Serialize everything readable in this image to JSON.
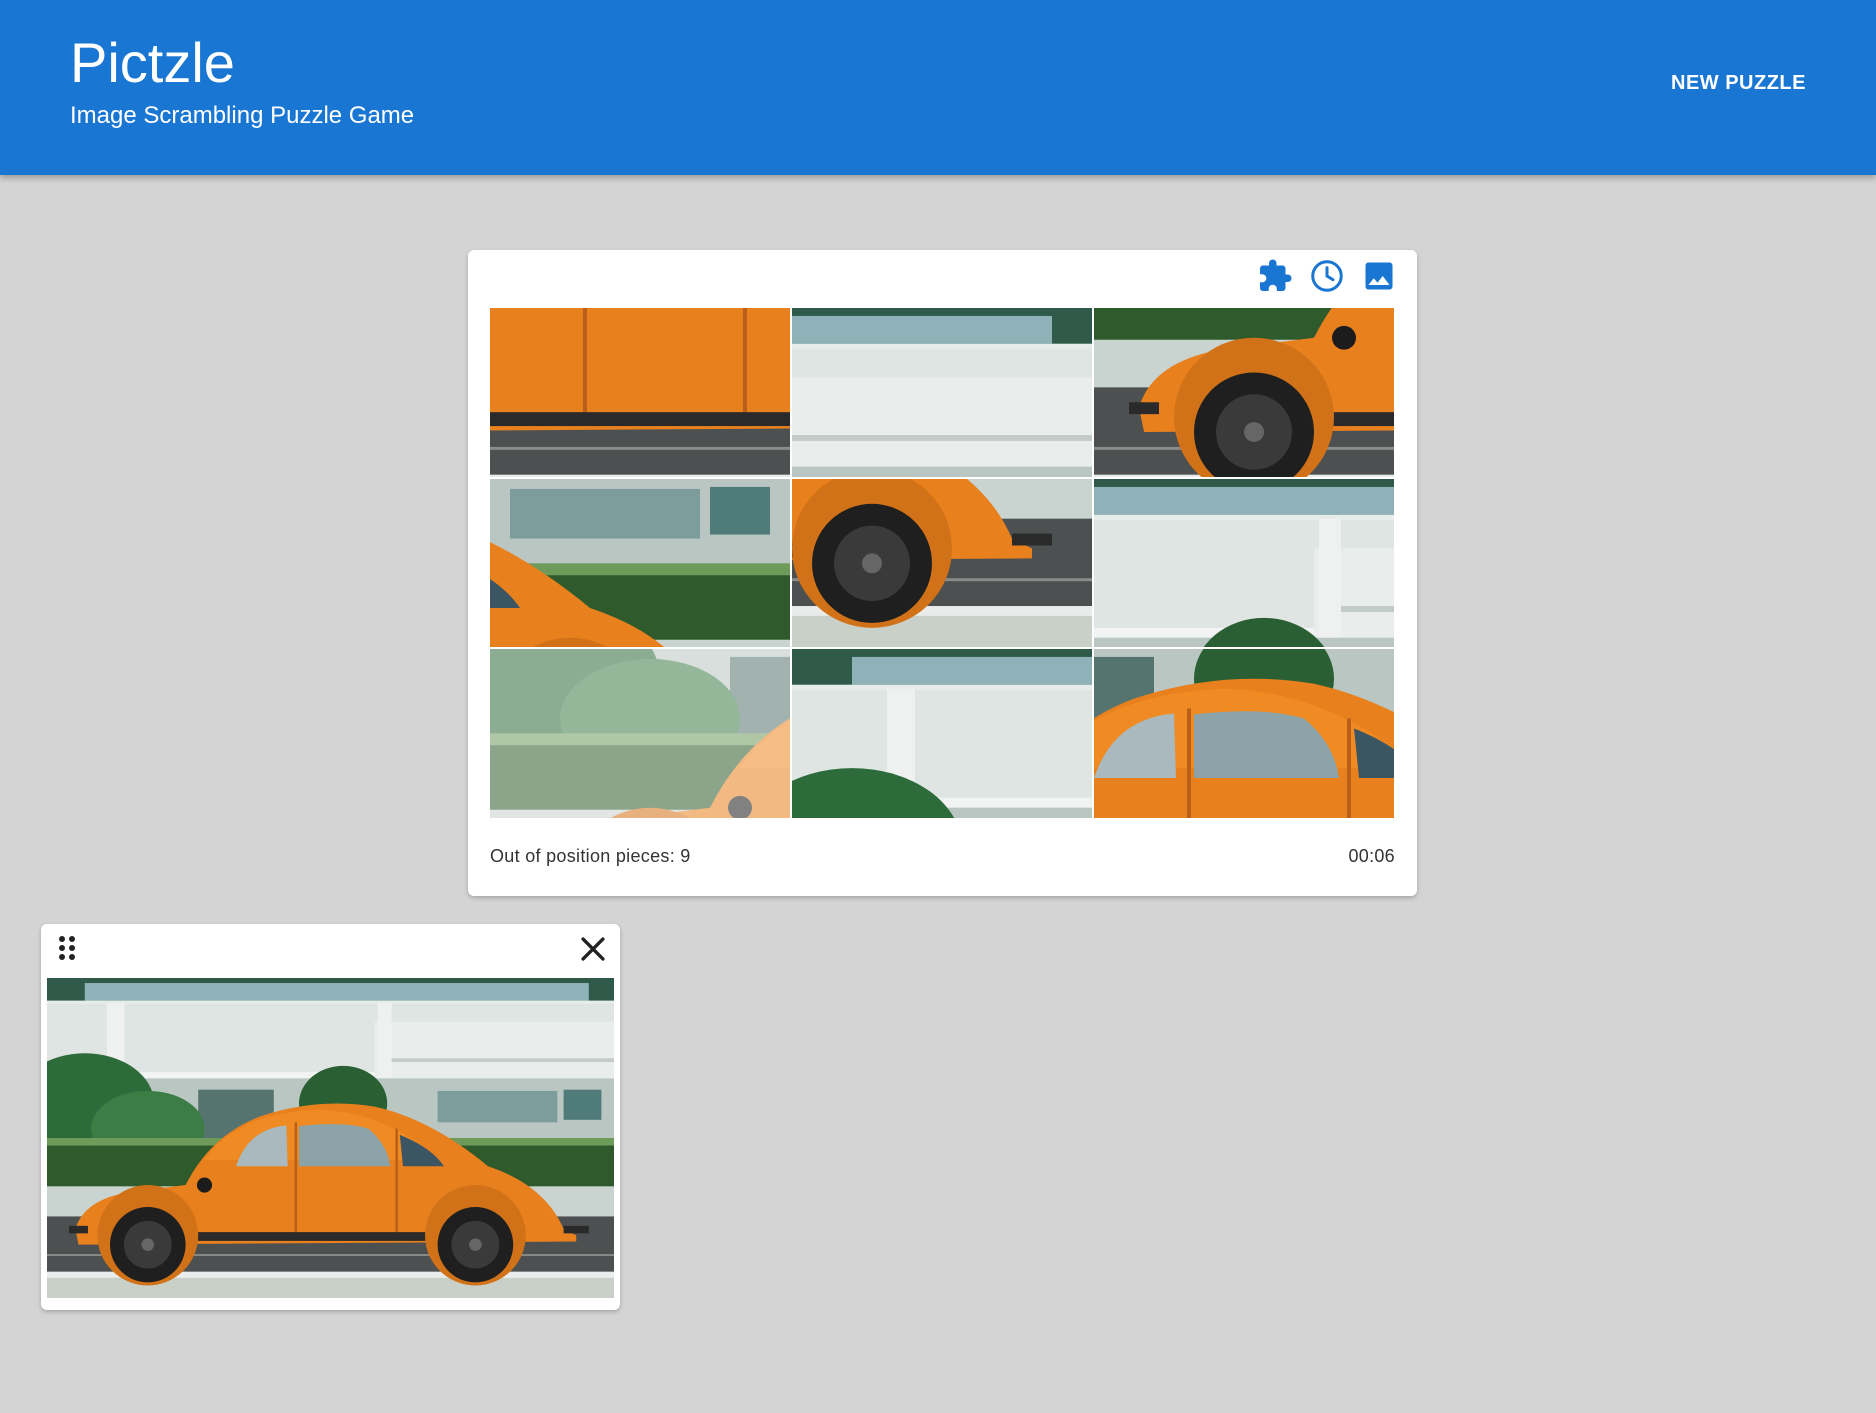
{
  "app": {
    "title": "Pictzle",
    "subtitle": "Image Scrambling Puzzle Game",
    "new_puzzle_label": "NEW PUZZLE"
  },
  "colors": {
    "primary": "#1976d2",
    "background": "#d4d4d4",
    "car_orange": "#e8801e"
  },
  "toolbar": {
    "icons": [
      "puzzle-icon",
      "clock-icon",
      "image-icon"
    ]
  },
  "puzzle": {
    "grid": "3x3",
    "status_label": "Out of position pieces: 9",
    "timer": "00:06"
  },
  "preview": {
    "drag_icon": "drag-handle-icon",
    "close_icon": "close-icon"
  }
}
